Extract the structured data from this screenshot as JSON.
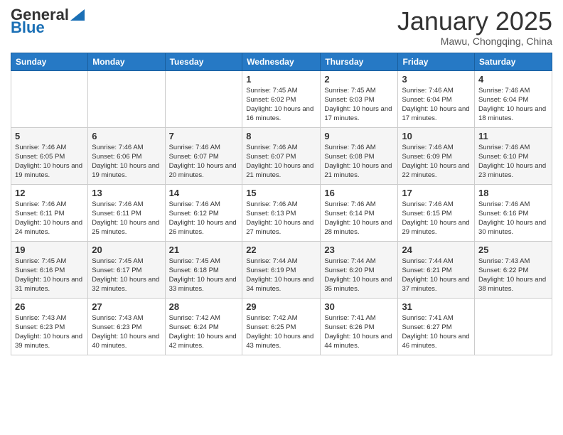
{
  "header": {
    "logo_general": "General",
    "logo_blue": "Blue",
    "month_title": "January 2025",
    "location": "Mawu, Chongqing, China"
  },
  "days_of_week": [
    "Sunday",
    "Monday",
    "Tuesday",
    "Wednesday",
    "Thursday",
    "Friday",
    "Saturday"
  ],
  "weeks": [
    [
      {
        "day": "",
        "info": ""
      },
      {
        "day": "",
        "info": ""
      },
      {
        "day": "",
        "info": ""
      },
      {
        "day": "1",
        "info": "Sunrise: 7:45 AM\nSunset: 6:02 PM\nDaylight: 10 hours and 16 minutes."
      },
      {
        "day": "2",
        "info": "Sunrise: 7:45 AM\nSunset: 6:03 PM\nDaylight: 10 hours and 17 minutes."
      },
      {
        "day": "3",
        "info": "Sunrise: 7:46 AM\nSunset: 6:04 PM\nDaylight: 10 hours and 17 minutes."
      },
      {
        "day": "4",
        "info": "Sunrise: 7:46 AM\nSunset: 6:04 PM\nDaylight: 10 hours and 18 minutes."
      }
    ],
    [
      {
        "day": "5",
        "info": "Sunrise: 7:46 AM\nSunset: 6:05 PM\nDaylight: 10 hours and 19 minutes."
      },
      {
        "day": "6",
        "info": "Sunrise: 7:46 AM\nSunset: 6:06 PM\nDaylight: 10 hours and 19 minutes."
      },
      {
        "day": "7",
        "info": "Sunrise: 7:46 AM\nSunset: 6:07 PM\nDaylight: 10 hours and 20 minutes."
      },
      {
        "day": "8",
        "info": "Sunrise: 7:46 AM\nSunset: 6:07 PM\nDaylight: 10 hours and 21 minutes."
      },
      {
        "day": "9",
        "info": "Sunrise: 7:46 AM\nSunset: 6:08 PM\nDaylight: 10 hours and 21 minutes."
      },
      {
        "day": "10",
        "info": "Sunrise: 7:46 AM\nSunset: 6:09 PM\nDaylight: 10 hours and 22 minutes."
      },
      {
        "day": "11",
        "info": "Sunrise: 7:46 AM\nSunset: 6:10 PM\nDaylight: 10 hours and 23 minutes."
      }
    ],
    [
      {
        "day": "12",
        "info": "Sunrise: 7:46 AM\nSunset: 6:11 PM\nDaylight: 10 hours and 24 minutes."
      },
      {
        "day": "13",
        "info": "Sunrise: 7:46 AM\nSunset: 6:11 PM\nDaylight: 10 hours and 25 minutes."
      },
      {
        "day": "14",
        "info": "Sunrise: 7:46 AM\nSunset: 6:12 PM\nDaylight: 10 hours and 26 minutes."
      },
      {
        "day": "15",
        "info": "Sunrise: 7:46 AM\nSunset: 6:13 PM\nDaylight: 10 hours and 27 minutes."
      },
      {
        "day": "16",
        "info": "Sunrise: 7:46 AM\nSunset: 6:14 PM\nDaylight: 10 hours and 28 minutes."
      },
      {
        "day": "17",
        "info": "Sunrise: 7:46 AM\nSunset: 6:15 PM\nDaylight: 10 hours and 29 minutes."
      },
      {
        "day": "18",
        "info": "Sunrise: 7:46 AM\nSunset: 6:16 PM\nDaylight: 10 hours and 30 minutes."
      }
    ],
    [
      {
        "day": "19",
        "info": "Sunrise: 7:45 AM\nSunset: 6:16 PM\nDaylight: 10 hours and 31 minutes."
      },
      {
        "day": "20",
        "info": "Sunrise: 7:45 AM\nSunset: 6:17 PM\nDaylight: 10 hours and 32 minutes."
      },
      {
        "day": "21",
        "info": "Sunrise: 7:45 AM\nSunset: 6:18 PM\nDaylight: 10 hours and 33 minutes."
      },
      {
        "day": "22",
        "info": "Sunrise: 7:44 AM\nSunset: 6:19 PM\nDaylight: 10 hours and 34 minutes."
      },
      {
        "day": "23",
        "info": "Sunrise: 7:44 AM\nSunset: 6:20 PM\nDaylight: 10 hours and 35 minutes."
      },
      {
        "day": "24",
        "info": "Sunrise: 7:44 AM\nSunset: 6:21 PM\nDaylight: 10 hours and 37 minutes."
      },
      {
        "day": "25",
        "info": "Sunrise: 7:43 AM\nSunset: 6:22 PM\nDaylight: 10 hours and 38 minutes."
      }
    ],
    [
      {
        "day": "26",
        "info": "Sunrise: 7:43 AM\nSunset: 6:23 PM\nDaylight: 10 hours and 39 minutes."
      },
      {
        "day": "27",
        "info": "Sunrise: 7:43 AM\nSunset: 6:23 PM\nDaylight: 10 hours and 40 minutes."
      },
      {
        "day": "28",
        "info": "Sunrise: 7:42 AM\nSunset: 6:24 PM\nDaylight: 10 hours and 42 minutes."
      },
      {
        "day": "29",
        "info": "Sunrise: 7:42 AM\nSunset: 6:25 PM\nDaylight: 10 hours and 43 minutes."
      },
      {
        "day": "30",
        "info": "Sunrise: 7:41 AM\nSunset: 6:26 PM\nDaylight: 10 hours and 44 minutes."
      },
      {
        "day": "31",
        "info": "Sunrise: 7:41 AM\nSunset: 6:27 PM\nDaylight: 10 hours and 46 minutes."
      },
      {
        "day": "",
        "info": ""
      }
    ]
  ]
}
